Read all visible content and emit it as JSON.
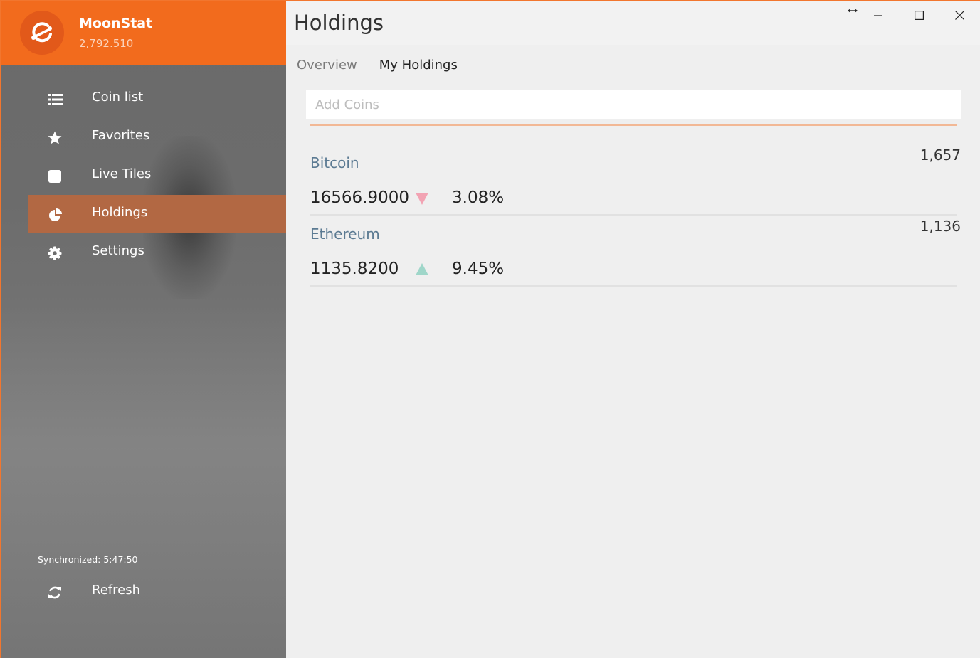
{
  "app": {
    "name": "MoonStat",
    "portfolio_value": "2,792.510",
    "accent_color": "#f26b1d"
  },
  "sidebar": {
    "items": [
      {
        "label": "Coin list",
        "icon": "list-icon",
        "active": false
      },
      {
        "label": "Favorites",
        "icon": "star-icon",
        "active": false
      },
      {
        "label": "Live Tiles",
        "icon": "tile-icon",
        "active": false
      },
      {
        "label": "Holdings",
        "icon": "pie-chart-icon",
        "active": true
      },
      {
        "label": "Settings",
        "icon": "gear-icon",
        "active": false
      }
    ],
    "sync_text": "Synchronized: 5:47:50",
    "refresh_label": "Refresh"
  },
  "header": {
    "title": "Holdings"
  },
  "tabs": [
    {
      "label": "Overview",
      "active": false
    },
    {
      "label": "My Holdings",
      "active": true
    }
  ],
  "search": {
    "placeholder": "Add Coins",
    "value": ""
  },
  "holdings": [
    {
      "name": "Bitcoin",
      "amount": "1,657",
      "price": "16566.9000",
      "trend": "down",
      "trend_color": "#f2a3b3",
      "change": "3.08%"
    },
    {
      "name": "Ethereum",
      "amount": "1,136",
      "price": "1135.8200",
      "trend": "up",
      "trend_color": "#9fd6c9",
      "change": "9.45%"
    }
  ]
}
